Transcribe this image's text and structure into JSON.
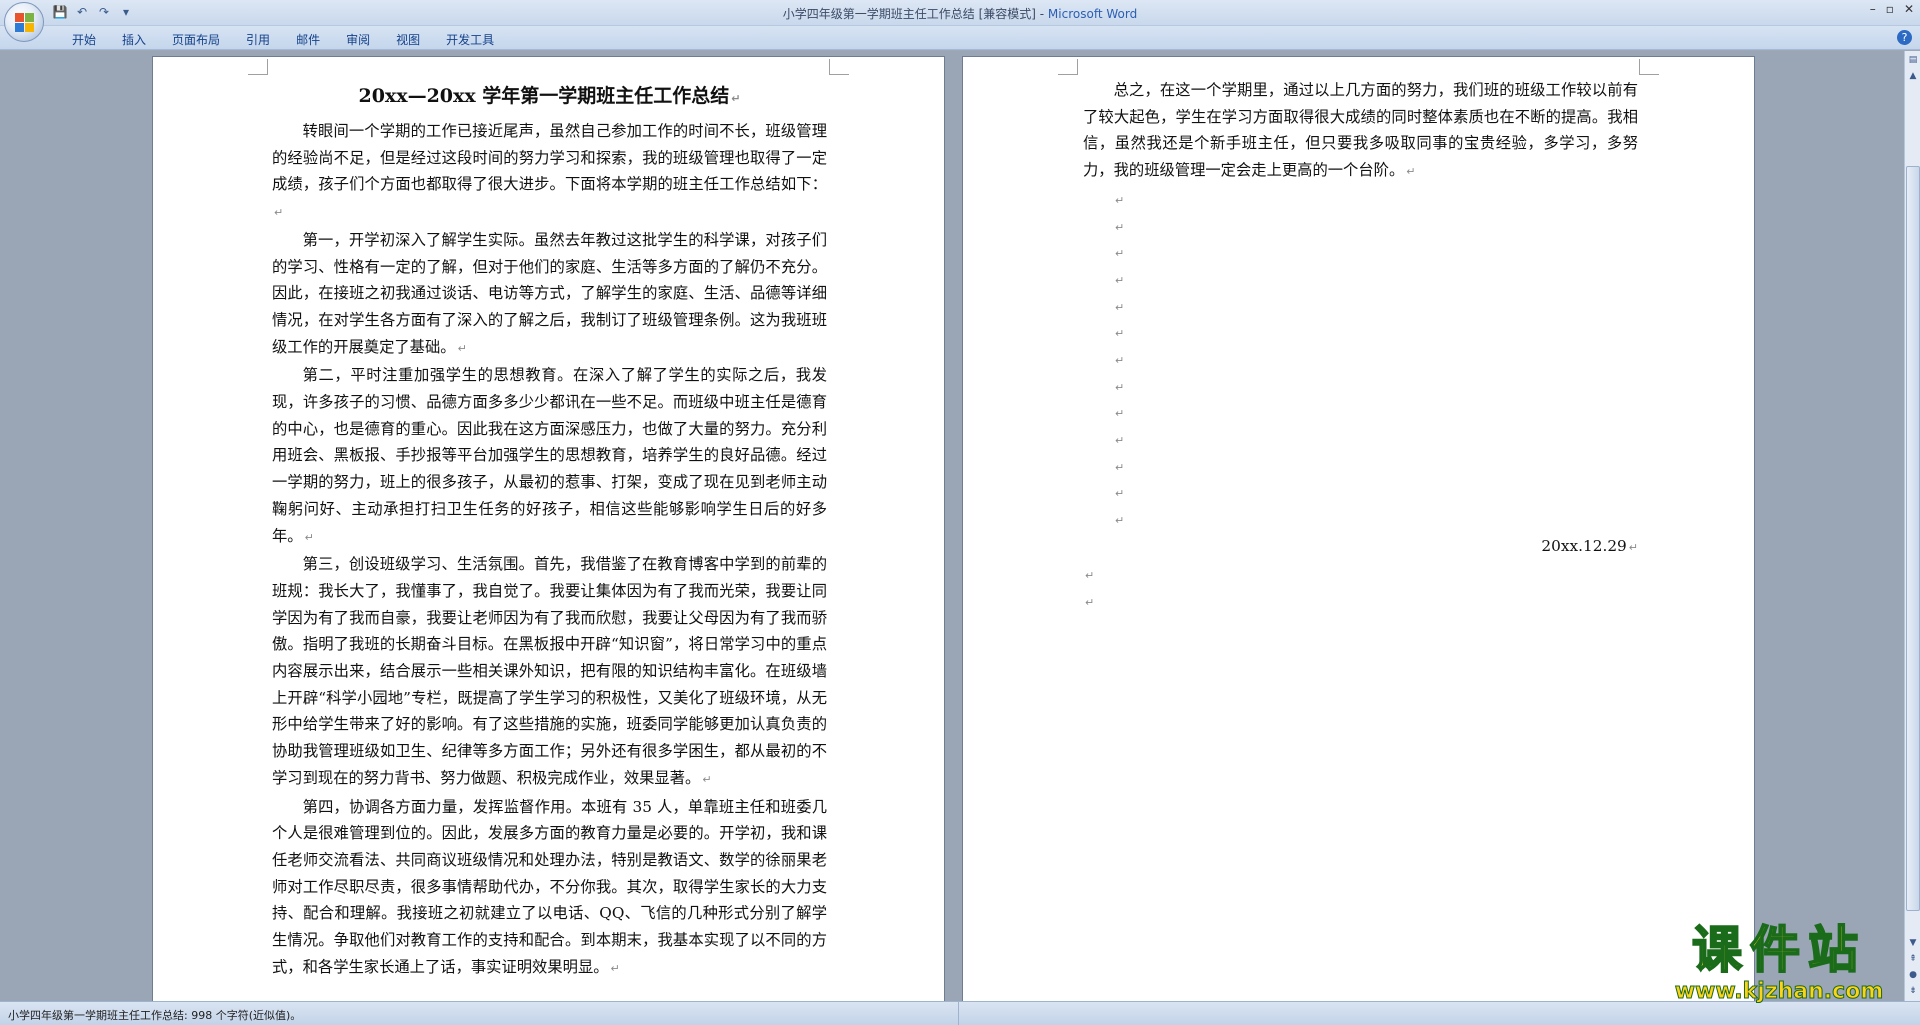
{
  "window": {
    "title": "小学四年级第一学期班主任工作总结 [兼容模式] - ",
    "app": "Microsoft Word",
    "controls": [
      "–",
      "▫",
      "✕"
    ]
  },
  "quick_access": [
    {
      "icon": "save-icon",
      "glyph": "💾"
    },
    {
      "icon": "undo-icon",
      "glyph": "↶"
    },
    {
      "icon": "redo-icon",
      "glyph": "↷"
    },
    {
      "icon": "customize-icon",
      "glyph": "▾"
    }
  ],
  "ribbon": {
    "tabs": [
      "开始",
      "插入",
      "页面布局",
      "引用",
      "邮件",
      "审阅",
      "视图",
      "开发工具"
    ]
  },
  "page1": {
    "title": "20xx—20xx 学年第一学期班主任工作总结",
    "paragraphs": [
      "转眼间一个学期的工作已接近尾声，虽然自己参加工作的时间不长，班级管理的经验尚不足，但是经过这段时间的努力学习和探索，我的班级管理也取得了一定成绩，孩子们个方面也都取得了很大进步。下面将本学期的班主任工作总结如下：",
      "第一，开学初深入了解学生实际。虽然去年教过这批学生的科学课，对孩子们的学习、性格有一定的了解，但对于他们的家庭、生活等多方面的了解仍不充分。因此，在接班之初我通过谈话、电访等方式，了解学生的家庭、生活、品德等详细情况，在对学生各方面有了深入的了解之后，我制订了班级管理条例。这为我班班级工作的开展奠定了基础。",
      "第二，平时注重加强学生的思想教育。在深入了解了学生的实际之后，我发现，许多孩子的习惯、品德方面多多少少都讯在一些不足。而班级中班主任是德育的中心，也是德育的重心。因此我在这方面深感压力，也做了大量的努力。充分利用班会、黑板报、手抄报等平台加强学生的思想教育，培养学生的良好品德。经过一学期的努力，班上的很多孩子，从最初的惹事、打架，变成了现在见到老师主动鞠躬问好、主动承担打扫卫生任务的好孩子，相信这些能够影响学生日后的好多年。",
      "第三，创设班级学习、生活氛围。首先，我借鉴了在教育博客中学到的前辈的班规：我长大了，我懂事了，我自觉了。我要让集体因为有了我而光荣，我要让同学因为有了我而自豪，我要让老师因为有了我而欣慰，我要让父母因为有了我而骄傲。指明了我班的长期奋斗目标。在黑板报中开辟“知识窗”，将日常学习中的重点内容展示出来，结合展示一些相关课外知识，把有限的知识结构丰富化。在班级墙上开辟“科学小园地”专栏，既提高了学生学习的积极性，又美化了班级环境，从无形中给学生带来了好的影响。有了这些措施的实施，班委同学能够更加认真负责的协助我管理班级如卫生、纪律等多方面工作；另外还有很多学困生，都从最初的不学习到现在的努力背书、努力做题、积极完成作业，效果显著。",
      "第四，协调各方面力量，发挥监督作用。本班有 35 人，单靠班主任和班委几个人是很难管理到位的。因此，发展多方面的教育力量是必要的。开学初，我和课任老师交流看法、共同商议班级情况和处理办法，特别是教语文、数学的徐丽果老师对工作尽职尽责，很多事情帮助代办，不分你我。其次，取得学生家长的大力支持、配合和理解。我接班之初就建立了以电话、QQ、飞信的几种形式分别了解学生情况。争取他们对教育工作的支持和配合。到本期末，我基本实现了以不同的方式，和各学生家长通上了话，事实证明效果明显。"
    ]
  },
  "page2": {
    "paragraph": "总之，在这一个学期里，通过以上几方面的努力，我们班的班级工作较以前有了较大起色，学生在学习方面取得很大成绩的同时整体素质也在不断的提高。我相信，虽然我还是个新手班主任，但只要我多吸取同事的宝贵经验，多学习，多努力，我的班级管理一定会走上更高的一个台阶。",
    "date": "20xx.12.29"
  },
  "marks": {
    "paragraph_mark": "↵"
  },
  "statusbar": {
    "text": "小学四年级第一学期班主任工作总结: 998 个字符(近似值)。"
  },
  "watermark": {
    "big": "课件站",
    "url": "www.kjzhan.com"
  }
}
